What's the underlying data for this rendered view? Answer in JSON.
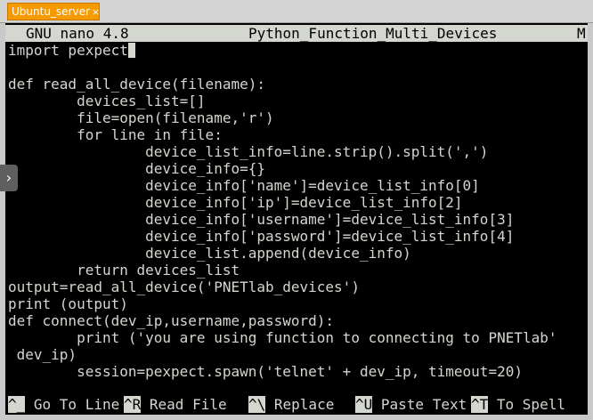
{
  "window": {
    "tab_label": "Ubuntu_server",
    "tab_close": "×"
  },
  "nano": {
    "version": "GNU nano 4.8",
    "filename": "Python_Function_Multi_Devices",
    "modified": "M"
  },
  "code": {
    "lines": [
      "import pexpect",
      "",
      "def read_all_device(filename):",
      "        devices_list=[]",
      "        file=open(filename,'r')",
      "        for line in file:",
      "                device_list_info=line.strip().split(',')",
      "                device_info={}",
      "                device_info['name']=device_list_info[0]",
      "                device_info['ip']=device_list_info[2]",
      "                device_info['username']=device_list_info[3]",
      "                device_info['password']=device_list_info[4]",
      "                device_list.append(device_info)",
      "        return devices_list",
      "output=read_all_device('PNETlab_devices')",
      "print (output)",
      "def connect(dev_ip,username,password):",
      "        print ('you are using function to connecting to PNETlab'",
      " dev_ip)",
      "        session=pexpect.spawn('telnet' + dev_ip, timeout=20)"
    ]
  },
  "shortcuts": [
    {
      "key": "^_",
      "label": "Go To Line"
    },
    {
      "key": "^R",
      "label": "Read File"
    },
    {
      "key": "^\\",
      "label": "Replace"
    },
    {
      "key": "^U",
      "label": "Paste Text"
    },
    {
      "key": "^T",
      "label": "To Spell"
    }
  ],
  "handle_icon": "chevron-right-icon",
  "colors": {
    "tab": "#f59a00",
    "terminal_bg": "#000000",
    "terminal_fg": "#d3d7cf"
  }
}
